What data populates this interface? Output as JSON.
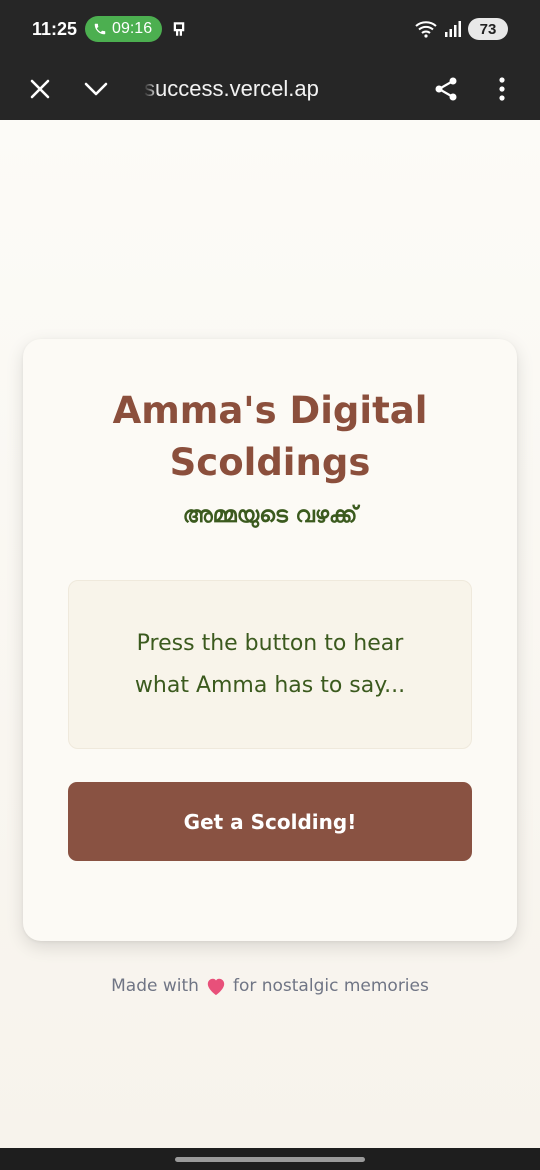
{
  "status_bar": {
    "time": "11:25",
    "call_timer": "09:16",
    "battery": "73"
  },
  "browser": {
    "url": "success.vercel.ap"
  },
  "card": {
    "title": "Amma's Digital Scoldings",
    "subtitle": "അമ്മയുടെ വഴക്ക്",
    "message": "Press the button to hear what Amma has to say...",
    "button_label": "Get a Scolding!"
  },
  "footer": {
    "prefix": "Made with",
    "suffix": "for nostalgic memories"
  },
  "colors": {
    "title": "#8b4f3c",
    "accent_green": "#3b5a1e",
    "button": "#895242",
    "background": "#fbf8f2"
  }
}
